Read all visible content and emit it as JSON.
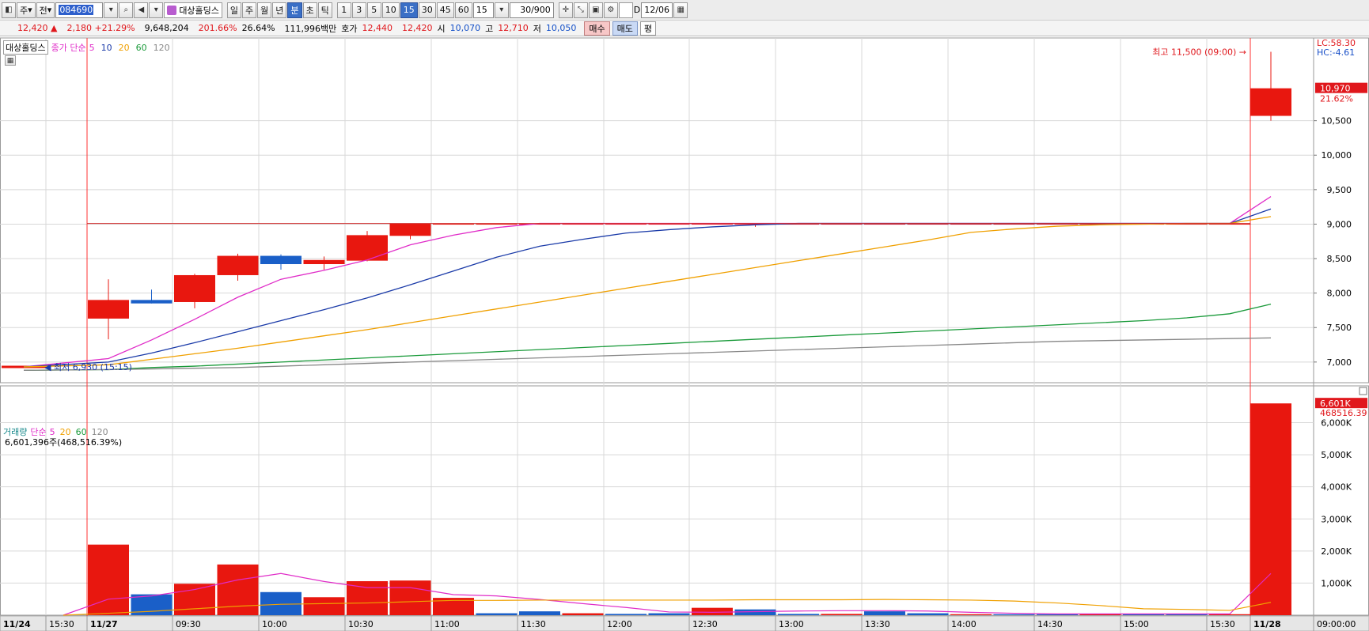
{
  "toolbar": {
    "market_label": "주",
    "prev_label": "전",
    "code": "084690",
    "stock_name": "대상홀딩스",
    "periods": [
      "일",
      "주",
      "월",
      "년",
      "분",
      "초",
      "틱"
    ],
    "active_period": "분",
    "intervals": [
      "1",
      "3",
      "5",
      "10",
      "15",
      "30",
      "45",
      "60"
    ],
    "active_interval": "15",
    "interval_select": "15",
    "count": "30/900",
    "date": "12/06",
    "checkbox_label": "D"
  },
  "quote": {
    "price": "12,420",
    "change": "2,180",
    "change_pct": "+21.29%",
    "volume": "9,648,204",
    "vol_ratio": "201.66%",
    "turnover": "26.64%",
    "amount": "111,996백만",
    "ask_label": "호가",
    "ask": "12,440",
    "bid": "12,420",
    "open_label": "시",
    "open": "10,070",
    "high_label": "고",
    "high": "12,710",
    "low_label": "저",
    "low": "10,050",
    "buy_label": "매수",
    "sell_label": "매도",
    "eval_label": "평"
  },
  "price_legend": {
    "name": "대상홀딩스",
    "close_label": "종가 단순",
    "ma": [
      {
        "label": "5",
        "color": "#e02cc8"
      },
      {
        "label": "10",
        "color": "#1a3aa8"
      },
      {
        "label": "20",
        "color": "#f0a000"
      },
      {
        "label": "60",
        "color": "#1a9a3a"
      },
      {
        "label": "120",
        "color": "#888888"
      }
    ]
  },
  "volume_legend": {
    "name": "거래량",
    "simple": "단순",
    "ma": [
      {
        "label": "5",
        "color": "#e02cc8"
      },
      {
        "label": "20",
        "color": "#f0a000"
      },
      {
        "label": "60",
        "color": "#1a9a3a"
      },
      {
        "label": "120",
        "color": "#888888"
      }
    ],
    "value_text": "6,601,396주(468,516.39%)"
  },
  "annotations": {
    "high_text": "최고 11,500 (09:00)",
    "low_text": "최저 6,930 (15:15)",
    "lc": "LC:58.30",
    "hc": "HC:-4.61",
    "last_price": "10,970",
    "last_pct": "21.62%",
    "last_volume": "6,601K",
    "last_volume_sub": "468516.39"
  },
  "colors": {
    "up": "#e8170f",
    "down": "#1a5fc8",
    "grid": "#d8d8d8",
    "marker": "#ff3030"
  },
  "chart_data": {
    "type": "candlestick",
    "x_labels": [
      "11/24",
      "15:30",
      "11/27",
      "09:30",
      "10:00",
      "10:30",
      "11:00",
      "11:30",
      "12:00",
      "12:30",
      "13:00",
      "13:30",
      "14:00",
      "14:30",
      "15:00",
      "15:30",
      "11/28",
      "09:00:00"
    ],
    "y_ticks": [
      7000,
      7500,
      8000,
      8500,
      9000,
      9500,
      10000,
      10500
    ],
    "y_tick_labels": [
      "7,000",
      "7,500",
      "8,000",
      "8,500",
      "9,000",
      "9,500",
      "10,000",
      "10,500"
    ],
    "ylim": [
      6700,
      11700
    ],
    "vol_ticks": [
      1000,
      2000,
      3000,
      4000,
      5000,
      6000
    ],
    "vol_tick_labels": [
      "1,000K",
      "2,000K",
      "3,000K",
      "4,000K",
      "5,000K",
      "6,000K"
    ],
    "vol_ylim": [
      0,
      6900
    ],
    "candles": [
      {
        "t": "11/24 15:15",
        "o": 6930,
        "h": 6930,
        "l": 6930,
        "c": 6930,
        "v": 0
      },
      {
        "t": "11/27 09:00",
        "o": 7630,
        "h": 8200,
        "l": 7330,
        "c": 7900,
        "v": 2200
      },
      {
        "t": "09:15",
        "o": 7900,
        "h": 8050,
        "l": 7850,
        "c": 7850,
        "v": 650
      },
      {
        "t": "09:30",
        "o": 7870,
        "h": 8280,
        "l": 7780,
        "c": 8260,
        "v": 980
      },
      {
        "t": "09:45",
        "o": 8260,
        "h": 8570,
        "l": 8180,
        "c": 8540,
        "v": 1580
      },
      {
        "t": "10:00",
        "o": 8540,
        "h": 8560,
        "l": 8340,
        "c": 8420,
        "v": 720
      },
      {
        "t": "10:15",
        "o": 8420,
        "h": 8530,
        "l": 8340,
        "c": 8480,
        "v": 560
      },
      {
        "t": "10:30",
        "o": 8470,
        "h": 8900,
        "l": 8460,
        "c": 8840,
        "v": 1060
      },
      {
        "t": "10:45",
        "o": 8830,
        "h": 9010,
        "l": 8780,
        "c": 9010,
        "v": 1080
      },
      {
        "t": "11:00",
        "o": 9010,
        "h": 9010,
        "l": 9010,
        "c": 9010,
        "v": 540
      },
      {
        "t": "11:15",
        "o": 9010,
        "h": 9010,
        "l": 9010,
        "c": 9010,
        "v": 60
      },
      {
        "t": "11:30",
        "o": 9010,
        "h": 9010,
        "l": 9010,
        "c": 9010,
        "v": 120
      },
      {
        "t": "11:45",
        "o": 9010,
        "h": 9010,
        "l": 9010,
        "c": 9010,
        "v": 60
      },
      {
        "t": "12:00",
        "o": 9010,
        "h": 9010,
        "l": 9010,
        "c": 9010,
        "v": 40
      },
      {
        "t": "12:15",
        "o": 9010,
        "h": 9010,
        "l": 9010,
        "c": 9010,
        "v": 60
      },
      {
        "t": "12:30",
        "o": 9010,
        "h": 9010,
        "l": 9010,
        "c": 9010,
        "v": 230
      },
      {
        "t": "12:45",
        "o": 9010,
        "h": 9010,
        "l": 8960,
        "c": 9010,
        "v": 180
      },
      {
        "t": "13:00",
        "o": 9010,
        "h": 9010,
        "l": 9010,
        "c": 9010,
        "v": 40
      },
      {
        "t": "13:15",
        "o": 9010,
        "h": 9010,
        "l": 9010,
        "c": 9010,
        "v": 40
      },
      {
        "t": "13:30",
        "o": 9010,
        "h": 9010,
        "l": 9010,
        "c": 9010,
        "v": 120
      },
      {
        "t": "13:45",
        "o": 9010,
        "h": 9010,
        "l": 9010,
        "c": 9010,
        "v": 60
      },
      {
        "t": "14:00",
        "o": 9010,
        "h": 9010,
        "l": 9010,
        "c": 9010,
        "v": 30
      },
      {
        "t": "14:15",
        "o": 9010,
        "h": 9010,
        "l": 9010,
        "c": 9010,
        "v": 30
      },
      {
        "t": "14:30",
        "o": 9010,
        "h": 9010,
        "l": 9010,
        "c": 9010,
        "v": 30
      },
      {
        "t": "14:45",
        "o": 9010,
        "h": 9010,
        "l": 9010,
        "c": 9010,
        "v": 30
      },
      {
        "t": "15:00",
        "o": 9010,
        "h": 9010,
        "l": 9010,
        "c": 9010,
        "v": 30
      },
      {
        "t": "15:15",
        "o": 9010,
        "h": 9010,
        "l": 9010,
        "c": 9010,
        "v": 30
      },
      {
        "t": "15:30",
        "o": 9010,
        "h": 9010,
        "l": 9010,
        "c": 9010,
        "v": 30
      },
      {
        "t": "11/28 09:00",
        "o": 10570,
        "h": 11500,
        "l": 10500,
        "c": 10970,
        "v": 6600
      }
    ],
    "ma_lines": {
      "5": [
        6930,
        7050,
        7320,
        7620,
        7940,
        8200,
        8330,
        8480,
        8700,
        8840,
        8950,
        9010,
        9010,
        9010,
        9010,
        9010,
        9010,
        9010,
        9010,
        9010,
        9010,
        9010,
        9010,
        9010,
        9010,
        9010,
        9010,
        9010,
        9400
      ],
      "10": [
        6930,
        7000,
        7130,
        7280,
        7440,
        7600,
        7760,
        7930,
        8120,
        8320,
        8520,
        8680,
        8780,
        8870,
        8920,
        8960,
        8990,
        9010,
        9010,
        9010,
        9010,
        9010,
        9010,
        9010,
        9010,
        9010,
        9010,
        9010,
        9220
      ],
      "20": [
        6930,
        6960,
        7040,
        7120,
        7200,
        7290,
        7380,
        7470,
        7570,
        7670,
        7770,
        7870,
        7970,
        8070,
        8170,
        8270,
        8370,
        8470,
        8570,
        8670,
        8770,
        8880,
        8930,
        8970,
        8990,
        9000,
        9010,
        9010,
        9110
      ],
      "60": [
        6880,
        6890,
        6920,
        6940,
        6970,
        7000,
        7030,
        7060,
        7090,
        7120,
        7150,
        7180,
        7210,
        7240,
        7270,
        7300,
        7330,
        7360,
        7390,
        7420,
        7450,
        7480,
        7510,
        7540,
        7570,
        7600,
        7640,
        7700,
        7840
      ],
      "120": [
        6880,
        6890,
        6900,
        6910,
        6920,
        6940,
        6960,
        6980,
        7000,
        7020,
        7040,
        7060,
        7080,
        7100,
        7120,
        7140,
        7160,
        7180,
        7200,
        7220,
        7240,
        7260,
        7280,
        7300,
        7310,
        7320,
        7330,
        7340,
        7350
      ]
    },
    "vol_ma_lines": {
      "5": [
        0,
        500,
        600,
        800,
        1100,
        1300,
        1050,
        860,
        860,
        640,
        600,
        490,
        360,
        240,
        100,
        90,
        110,
        130,
        140,
        140,
        130,
        90,
        60,
        40,
        40,
        40,
        40,
        40,
        1300
      ],
      "20": [
        0,
        60,
        120,
        200,
        280,
        340,
        360,
        380,
        420,
        460,
        460,
        470,
        470,
        470,
        470,
        470,
        480,
        480,
        480,
        490,
        480,
        470,
        440,
        380,
        300,
        200,
        180,
        150,
        400
      ]
    }
  }
}
